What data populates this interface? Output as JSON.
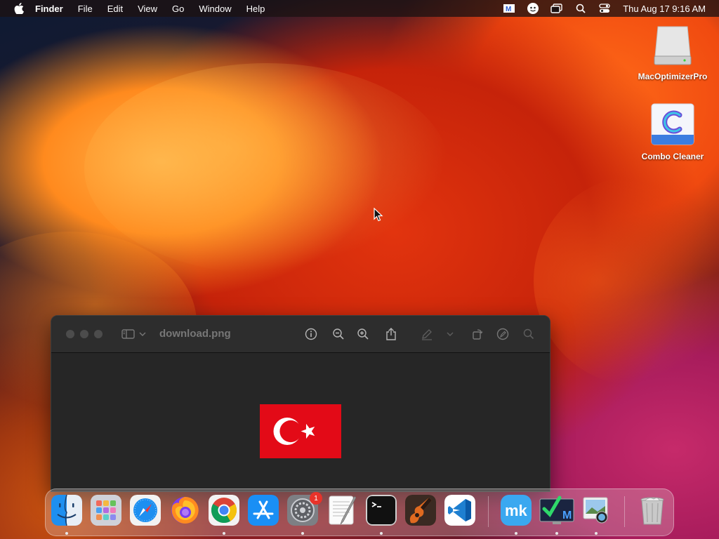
{
  "menubar": {
    "app_name": "Finder",
    "items": [
      "File",
      "Edit",
      "View",
      "Go",
      "Window",
      "Help"
    ],
    "clock": "Thu Aug 17  9:16 AM"
  },
  "desktop": {
    "icons": [
      {
        "label": "MacOptimizerPro",
        "icon": "drive-icon"
      },
      {
        "label": "Combo Cleaner",
        "icon": "combo-cleaner-icon"
      }
    ]
  },
  "preview_window": {
    "title": "download.png",
    "image": "turkey-flag"
  },
  "dock": {
    "apps": [
      "Finder",
      "Launchpad",
      "Safari",
      "Firefox",
      "Chrome",
      "App Store",
      "System Preferences",
      "TextEdit",
      "Terminal",
      "GarageBand",
      "Visual Studio Code",
      "MacKeeper",
      "Monitor",
      "Preview",
      "Trash"
    ],
    "badge_count": "1",
    "colors": {
      "flag_red": "#e30a17"
    }
  }
}
